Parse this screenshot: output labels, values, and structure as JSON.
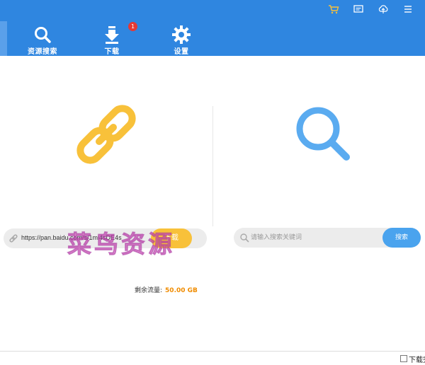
{
  "header": {
    "nav": [
      {
        "label": "资源搜索",
        "icon": "search-icon"
      },
      {
        "label": "下载",
        "icon": "download-icon",
        "badge": "1"
      },
      {
        "label": "设置",
        "icon": "gear-icon"
      }
    ],
    "window_controls": [
      "cart-icon",
      "message-icon",
      "cloud-icon",
      "menu-icon"
    ]
  },
  "link_panel": {
    "url_value": "https://pan.baidu.com/s/1mi4sDE4s",
    "go_label": "下载"
  },
  "search_panel": {
    "placeholder": "请输入搜索关键词",
    "button_label": "搜索"
  },
  "traffic": {
    "label": "剩余流量:",
    "value": "50.00 GB"
  },
  "watermark": "菜鸟资源",
  "footer": {
    "checkbox_label": "下载完"
  },
  "colors": {
    "header": "#2f86e0",
    "link_accent": "#f8c13a",
    "search_accent": "#4aa3ee",
    "traffic_value": "#f08c00",
    "badge": "#e53935"
  }
}
